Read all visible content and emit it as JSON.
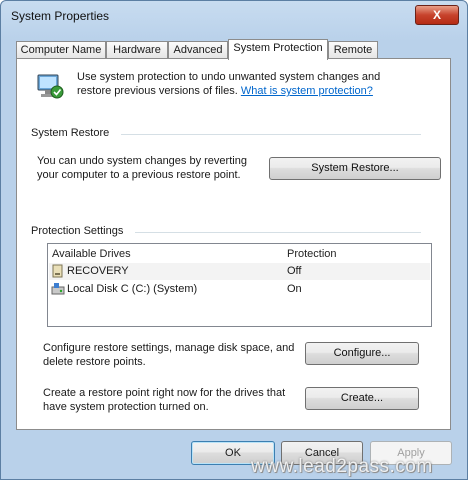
{
  "window": {
    "title": "System Properties",
    "close_glyph": "X"
  },
  "tabs": [
    {
      "label": "Computer Name"
    },
    {
      "label": "Hardware"
    },
    {
      "label": "Advanced"
    },
    {
      "label": "System Protection",
      "active": true
    },
    {
      "label": "Remote"
    }
  ],
  "intro": {
    "text_line1": "Use system protection to undo unwanted system changes and",
    "text_line2": "restore previous versions of files.",
    "link": "What is system protection?"
  },
  "system_restore": {
    "heading": "System Restore",
    "desc_line1": "You can undo system changes by reverting",
    "desc_line2": "your computer to a previous restore point.",
    "button": "System Restore..."
  },
  "protection_settings": {
    "heading": "Protection Settings",
    "columns": [
      "Available Drives",
      "Protection"
    ],
    "rows": [
      {
        "drive": "RECOVERY",
        "protection": "Off",
        "icon": "drive-icon"
      },
      {
        "drive": "Local Disk C (C:) (System)",
        "protection": "On",
        "icon": "system-drive-icon"
      }
    ],
    "configure_desc_line1": "Configure restore settings, manage disk space, and",
    "configure_desc_line2": "delete restore points.",
    "configure_button": "Configure...",
    "create_desc_line1": "Create a restore point right now for the drives that",
    "create_desc_line2": "have system protection turned on.",
    "create_button": "Create..."
  },
  "footer": {
    "ok": "OK",
    "cancel": "Cancel",
    "apply": "Apply"
  },
  "watermark": "www.lead2pass.com",
  "colors": {
    "link": "#0066cc",
    "accent": "#b9d1ea",
    "close_button": "#c7432c"
  }
}
